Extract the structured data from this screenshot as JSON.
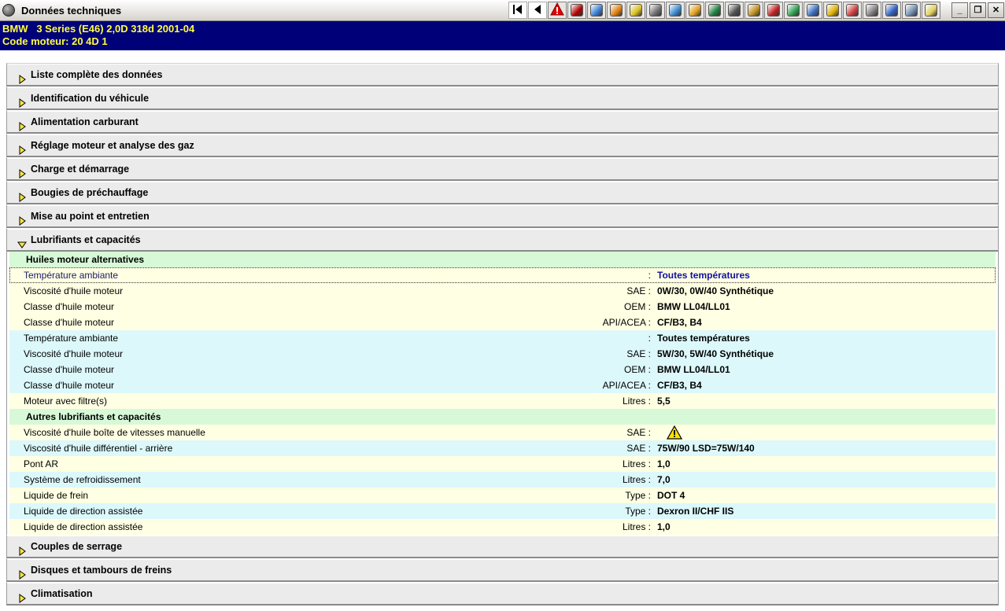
{
  "window": {
    "title": "Données techniques",
    "app_icon": "app-logo-icon",
    "controls": [
      "minimize",
      "restore",
      "close"
    ]
  },
  "toolbar": {
    "buttons": [
      {
        "name": "first-page-icon",
        "color": "#000000"
      },
      {
        "name": "previous-icon",
        "color": "#000000"
      },
      {
        "name": "warning-icon",
        "color": "#d00000"
      },
      {
        "name": "red-black-block-icon",
        "color": "#b00000"
      },
      {
        "name": "screen-blue-icon",
        "color": "#3a7fd8"
      },
      {
        "name": "gear-flame-icon",
        "color": "#e08010"
      },
      {
        "name": "belt-tool-icon",
        "color": "#d8c020"
      },
      {
        "name": "wheel-disc-icon",
        "color": "#707070"
      },
      {
        "name": "cross-tool-icon",
        "color": "#3a8ad0"
      },
      {
        "name": "fuel-gauge-icon",
        "color": "#e0a020"
      },
      {
        "name": "floppy-icon",
        "color": "#208040"
      },
      {
        "name": "dashboard-icon",
        "color": "#505050"
      },
      {
        "name": "wrench-icon",
        "color": "#c09020"
      },
      {
        "name": "battery-icon",
        "color": "#c02020"
      },
      {
        "name": "document-green-icon",
        "color": "#30a050"
      },
      {
        "name": "engine-icon",
        "color": "#3a70c0"
      },
      {
        "name": "question-person-icon",
        "color": "#e0b000"
      },
      {
        "name": "checklist-icon",
        "color": "#d04040"
      },
      {
        "name": "circle-gray-icon",
        "color": "#808080"
      },
      {
        "name": "triangle-sign-icon",
        "color": "#3060c0"
      },
      {
        "name": "chain-icon",
        "color": "#7090b0"
      },
      {
        "name": "note-icon",
        "color": "#e0d060"
      }
    ]
  },
  "vehicle": {
    "line1": "BMW   3 Series (E46) 2,0D 318d 2001-04",
    "line2": "Code moteur: 20 4D 1"
  },
  "sections_before": [
    "Liste complète des données",
    "Identification du véhicule",
    "Alimentation carburant",
    "Réglage moteur et analyse des gaz",
    "Charge et démarrage",
    "Bougies de préchauffage",
    "Mise au point et entretien"
  ],
  "expanded_section": {
    "title": "Lubrifiants et capacités",
    "groups": [
      {
        "title": "Huiles moteur alternatives",
        "rows": [
          {
            "label": "Température ambiante",
            "unit": ":",
            "value": "Toutes températures",
            "bg": "y",
            "focus": true
          },
          {
            "label": "Viscosité d'huile moteur",
            "unit": "SAE :",
            "value": "0W/30, 0W/40 Synthétique",
            "bg": "y"
          },
          {
            "label": "Classe d'huile moteur",
            "unit": "OEM :",
            "value": "BMW LL04/LL01",
            "bg": "y"
          },
          {
            "label": "Classe d'huile moteur",
            "unit": "API/ACEA :",
            "value": "CF/B3, B4",
            "bg": "y"
          },
          {
            "label": "Température ambiante",
            "unit": ":",
            "value": "Toutes températures",
            "bg": "c"
          },
          {
            "label": "Viscosité d'huile moteur",
            "unit": "SAE :",
            "value": "5W/30, 5W/40 Synthétique",
            "bg": "c"
          },
          {
            "label": "Classe d'huile moteur",
            "unit": "OEM :",
            "value": "BMW LL04/LL01",
            "bg": "c"
          },
          {
            "label": "Classe d'huile moteur",
            "unit": "API/ACEA :",
            "value": "CF/B3, B4",
            "bg": "c"
          },
          {
            "label": "Moteur avec filtre(s)",
            "unit": "Litres :",
            "value": "5,5",
            "bg": "y"
          }
        ]
      },
      {
        "title": "Autres lubrifiants et capacités",
        "rows": [
          {
            "label": "Viscosité d'huile boîte de vitesses manuelle",
            "unit": "SAE :",
            "value": "",
            "icon": "warning-icon",
            "bg": "y"
          },
          {
            "label": "Viscosité d'huile différentiel - arrière",
            "unit": "SAE :",
            "value": "75W/90 LSD=75W/140",
            "bg": "c"
          },
          {
            "label": "Pont AR",
            "unit": "Litres :",
            "value": "1,0",
            "bg": "y"
          },
          {
            "label": "Système de refroidissement",
            "unit": "Litres :",
            "value": "7,0",
            "bg": "c"
          },
          {
            "label": "Liquide de frein",
            "unit": "Type :",
            "value": "DOT 4",
            "bg": "y"
          },
          {
            "label": "Liquide de direction assistée",
            "unit": "Type :",
            "value": "Dexron II/CHF IIS",
            "bg": "c"
          },
          {
            "label": "Liquide de direction assistée",
            "unit": "Litres :",
            "value": "1,0",
            "bg": "y"
          }
        ]
      }
    ]
  },
  "sections_after": [
    "Couples de serrage",
    "Disques et tambours de freins",
    "Climatisation"
  ]
}
